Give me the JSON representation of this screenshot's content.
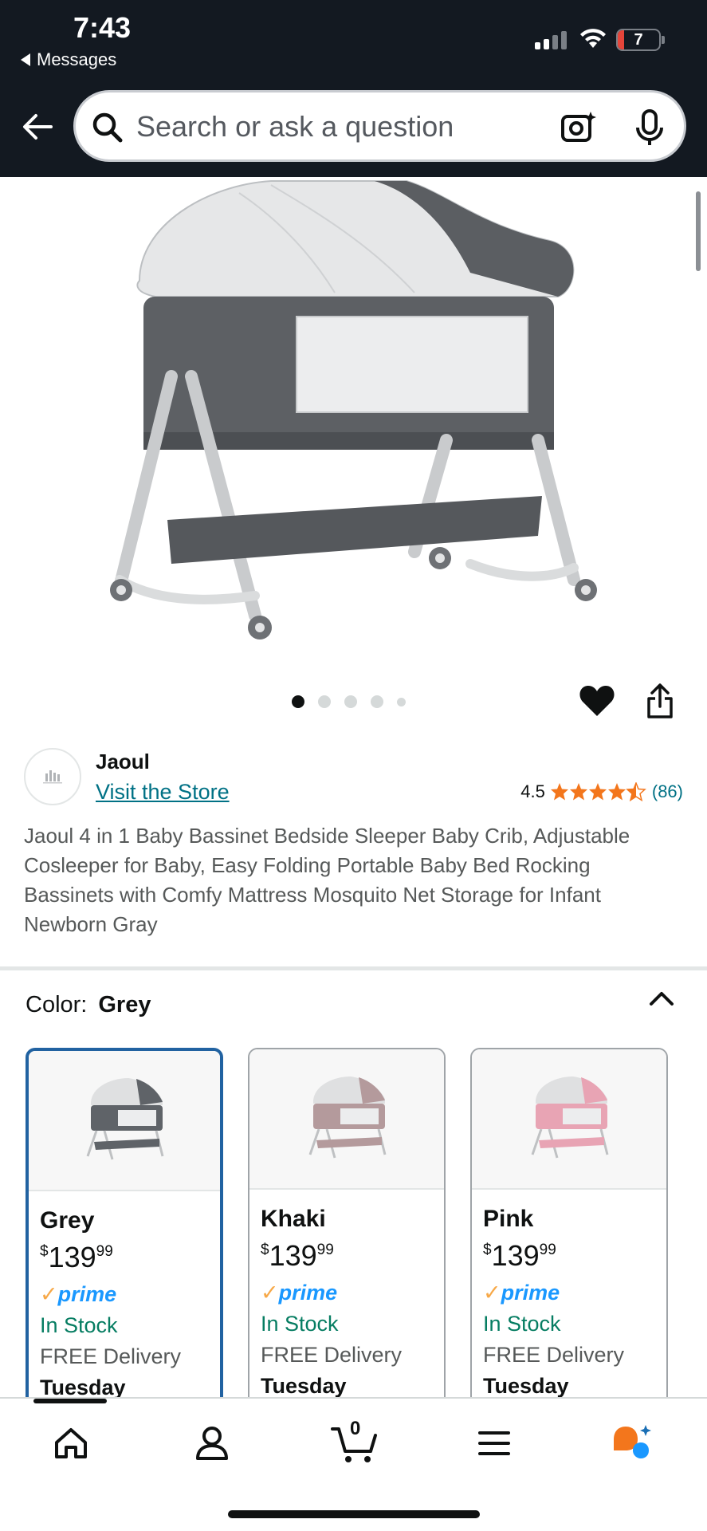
{
  "status_bar": {
    "time": "7:43",
    "back_app": "Messages",
    "battery_level": "7"
  },
  "header": {
    "search_placeholder": "Search or ask a question"
  },
  "gallery": {
    "image_count": 5,
    "active_index": 0
  },
  "brand": {
    "name": "Jaoul",
    "store_link": "Visit the Store"
  },
  "rating": {
    "value": "4.5",
    "count": "(86)",
    "stars": 4.5
  },
  "product_title": "Jaoul 4 in 1 Baby Bassinet Bedside Sleeper Baby Crib, Adjustable Cosleeper for Baby, Easy Folding Portable Baby Bed Rocking Bassinets with Comfy Mattress Mosquito Net Storage for Infant Newborn Gray",
  "color_selector": {
    "label": "Color:",
    "selected": "Grey",
    "options": [
      {
        "name": "Grey",
        "price_whole": "139",
        "price_fraction": "99",
        "currency": "$",
        "prime": "prime",
        "stock": "In Stock",
        "delivery": "FREE Delivery",
        "day": "Tuesday",
        "color": "#5f6368"
      },
      {
        "name": "Khaki",
        "price_whole": "139",
        "price_fraction": "99",
        "currency": "$",
        "prime": "prime",
        "stock": "In Stock",
        "delivery": "FREE Delivery",
        "day": "Tuesday",
        "color": "#b49a9c"
      },
      {
        "name": "Pink",
        "price_whole": "139",
        "price_fraction": "99",
        "currency": "$",
        "prime": "prime",
        "stock": "In Stock",
        "delivery": "FREE Delivery",
        "day": "Tuesday",
        "color": "#e8a4b4"
      }
    ]
  },
  "bottom_nav": {
    "cart_count": "0",
    "icons": [
      "home-icon",
      "account-icon",
      "cart-icon",
      "menu-icon",
      "rufus-icon"
    ]
  },
  "colors": {
    "header_bg": "#131921",
    "link": "#007185",
    "star": "#f3761c",
    "stock": "#067d62",
    "selected_border": "#2162a1",
    "prime": "#1a98ff"
  }
}
